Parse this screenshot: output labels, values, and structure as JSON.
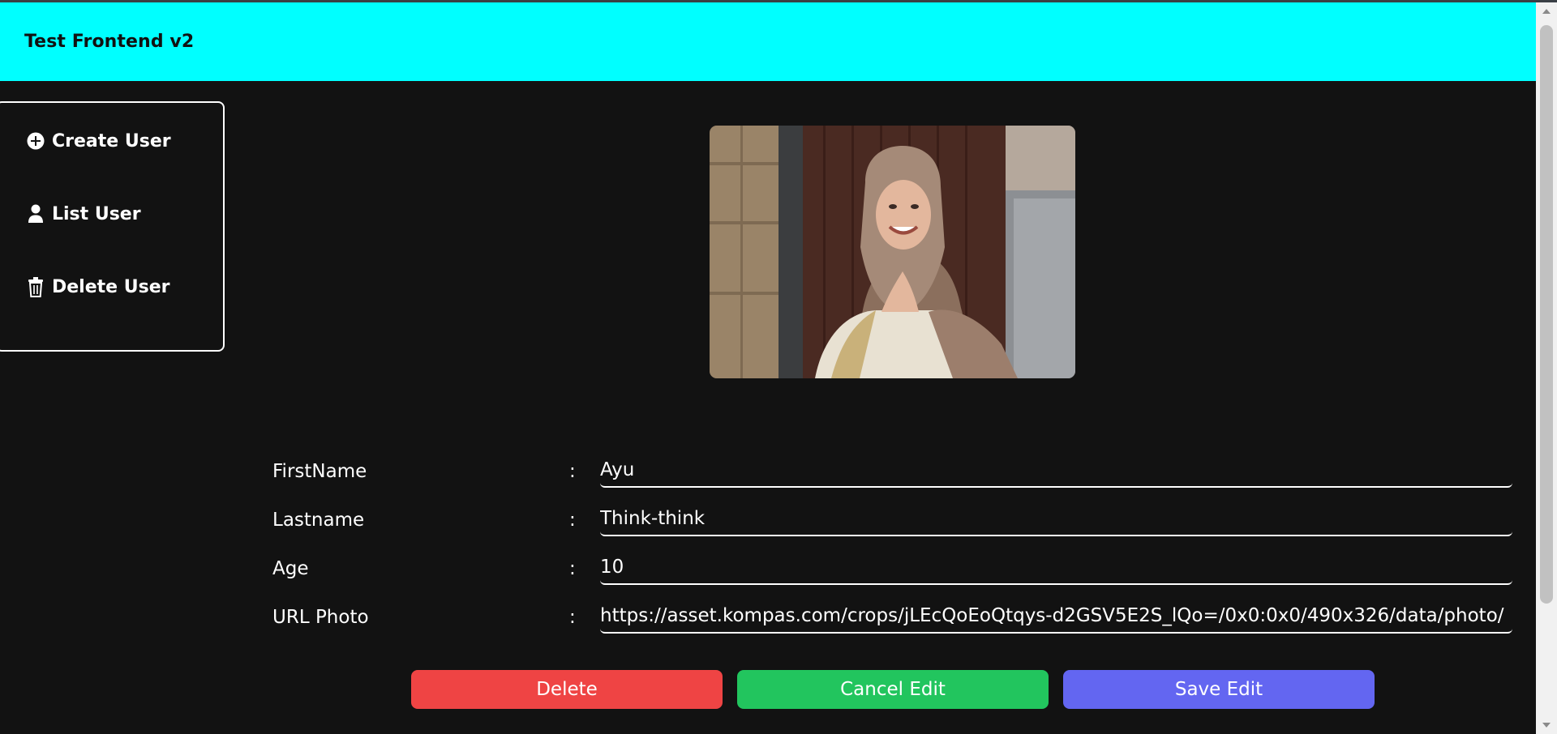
{
  "header": {
    "title": "Test Frontend v2",
    "bg_color": "#00ffff"
  },
  "sidebar": {
    "items": [
      {
        "label": "Create User",
        "icon": "plus-circle-icon"
      },
      {
        "label": "List User",
        "icon": "user-icon"
      },
      {
        "label": "Delete User",
        "icon": "trash-icon"
      }
    ]
  },
  "form": {
    "fields": [
      {
        "label": "FirstName",
        "colon": ":",
        "value": "Ayu"
      },
      {
        "label": "Lastname",
        "colon": ":",
        "value": "Think-think"
      },
      {
        "label": "Age",
        "colon": ":",
        "value": "10"
      },
      {
        "label": "URL Photo",
        "colon": ":",
        "value": "https://asset.kompas.com/crops/jLEcQoEoQtqys-d2GSV5E2S_lQo=/0x0:0x0/490x326/data/photo/"
      }
    ]
  },
  "actions": {
    "delete_label": "Delete",
    "cancel_label": "Cancel Edit",
    "save_label": "Save Edit"
  },
  "colors": {
    "background": "#121212",
    "delete": "#ef4444",
    "cancel": "#22c55e",
    "save": "#6366f1"
  }
}
